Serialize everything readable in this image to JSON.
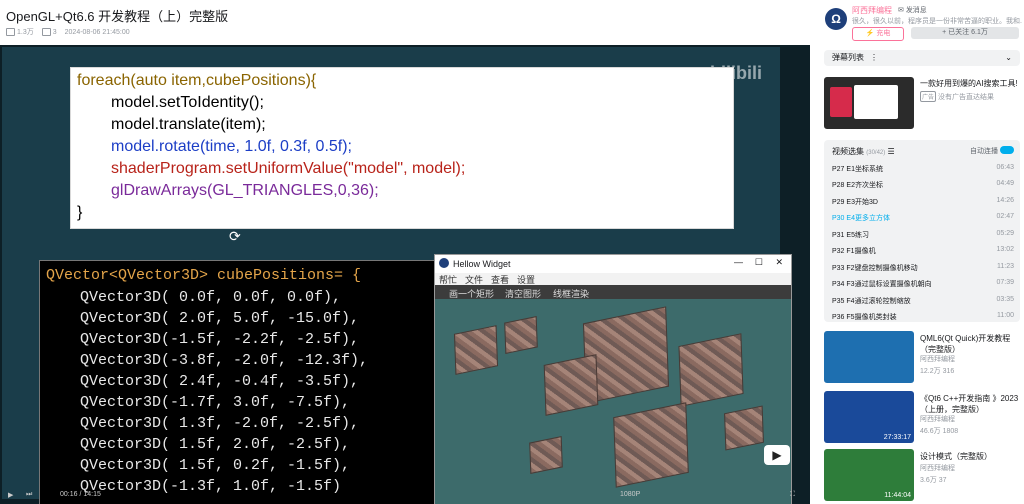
{
  "video": {
    "title": "OpenGL+Qt6.6 开发教程（上）完整版",
    "views": "1.3万",
    "danmaku_count": "3",
    "date": "2024-08-06 21:45:00"
  },
  "slide_code": {
    "lines": [
      "foreach(auto item,cubePositions){",
      "model.setToIdentity();",
      "model.translate(item);",
      "model.rotate(time, 1.0f, 0.3f, 0.5f);",
      "shaderProgram.setUniformValue(\"model\", model);",
      "glDrawArrays(GL_TRIANGLES,0,36);",
      "}"
    ],
    "watermark": "bilibili"
  },
  "vector_code": {
    "header": "QVector<QVector3D> cubePositions= {",
    "rows": [
      "QVector3D( 0.0f, 0.0f, 0.0f),",
      "QVector3D( 2.0f, 5.0f, -15.0f),",
      "QVector3D(-1.5f, -2.2f, -2.5f),",
      "QVector3D(-3.8f, -2.0f, -12.3f),",
      "QVector3D( 2.4f, -0.4f, -3.5f),",
      "QVector3D(-1.7f, 3.0f, -7.5f),",
      "QVector3D( 1.3f, -2.0f, -2.5f),",
      "QVector3D( 1.5f, 2.0f, -2.5f),",
      "QVector3D( 1.5f, 0.2f, -1.5f),",
      "QVector3D(-1.3f, 1.0f, -1.5f)"
    ]
  },
  "widget": {
    "title": "Hellow Widget",
    "menu": [
      "帮忙",
      "文件",
      "查看",
      "设置"
    ],
    "toolbar": [
      "画一个矩形",
      "清空图形",
      "线框渲染"
    ]
  },
  "player": {
    "time": "00:16 / 14:15",
    "quality": "1080P"
  },
  "uploader": {
    "name": "阿西拜编程",
    "message": "发消息",
    "desc": "很久，很久以前，程序员是一份非常苦逼的职业。我和...",
    "charge": "充电",
    "follow": "+ 已关注 6.1万"
  },
  "danmaku_list": {
    "label": "弹幕列表"
  },
  "ad": {
    "title": "一款好用到爆的AI搜索工具!",
    "tag": "广告",
    "sub": "没有广告直达结果"
  },
  "episodes": {
    "header": "视频选集",
    "count": "(30/42)",
    "autoplay": "自动连播",
    "items": [
      {
        "label": "P27  E1坐标系统",
        "dur": "06:43"
      },
      {
        "label": "P28  E2齐次坐标",
        "dur": "04:49"
      },
      {
        "label": "P29  E3开始3D",
        "dur": "14:26"
      },
      {
        "label": "P30  E4更多立方体",
        "dur": "02:47"
      },
      {
        "label": "P31  E5练习",
        "dur": "05:29"
      },
      {
        "label": "P32  F1摄像机",
        "dur": "13:02"
      },
      {
        "label": "P33  F2键盘控制摄像机移动",
        "dur": "11:23"
      },
      {
        "label": "P34  F3通过鼠标设置摄像机朝向",
        "dur": "07:39"
      },
      {
        "label": "P35  F4通过滚轮控制缩放",
        "dur": "03:35"
      },
      {
        "label": "P36  F5摄像机类封装",
        "dur": "11:00"
      }
    ]
  },
  "recommendations": [
    {
      "title": "QML6(Qt Quick)开发教程（完整版）",
      "up": "阿西拜编程",
      "views": "12.2万",
      "danmaku": "316"
    },
    {
      "title": "《Qt6 C++开发指南 》2023（上册，完整版）",
      "up": "阿西拜编程",
      "views": "46.6万",
      "danmaku": "1808",
      "duration": "27:33:17"
    },
    {
      "title": "设计模式（完整版）",
      "up": "阿西拜编程",
      "views": "3.6万",
      "danmaku": "37",
      "duration": "11:44:04"
    }
  ]
}
